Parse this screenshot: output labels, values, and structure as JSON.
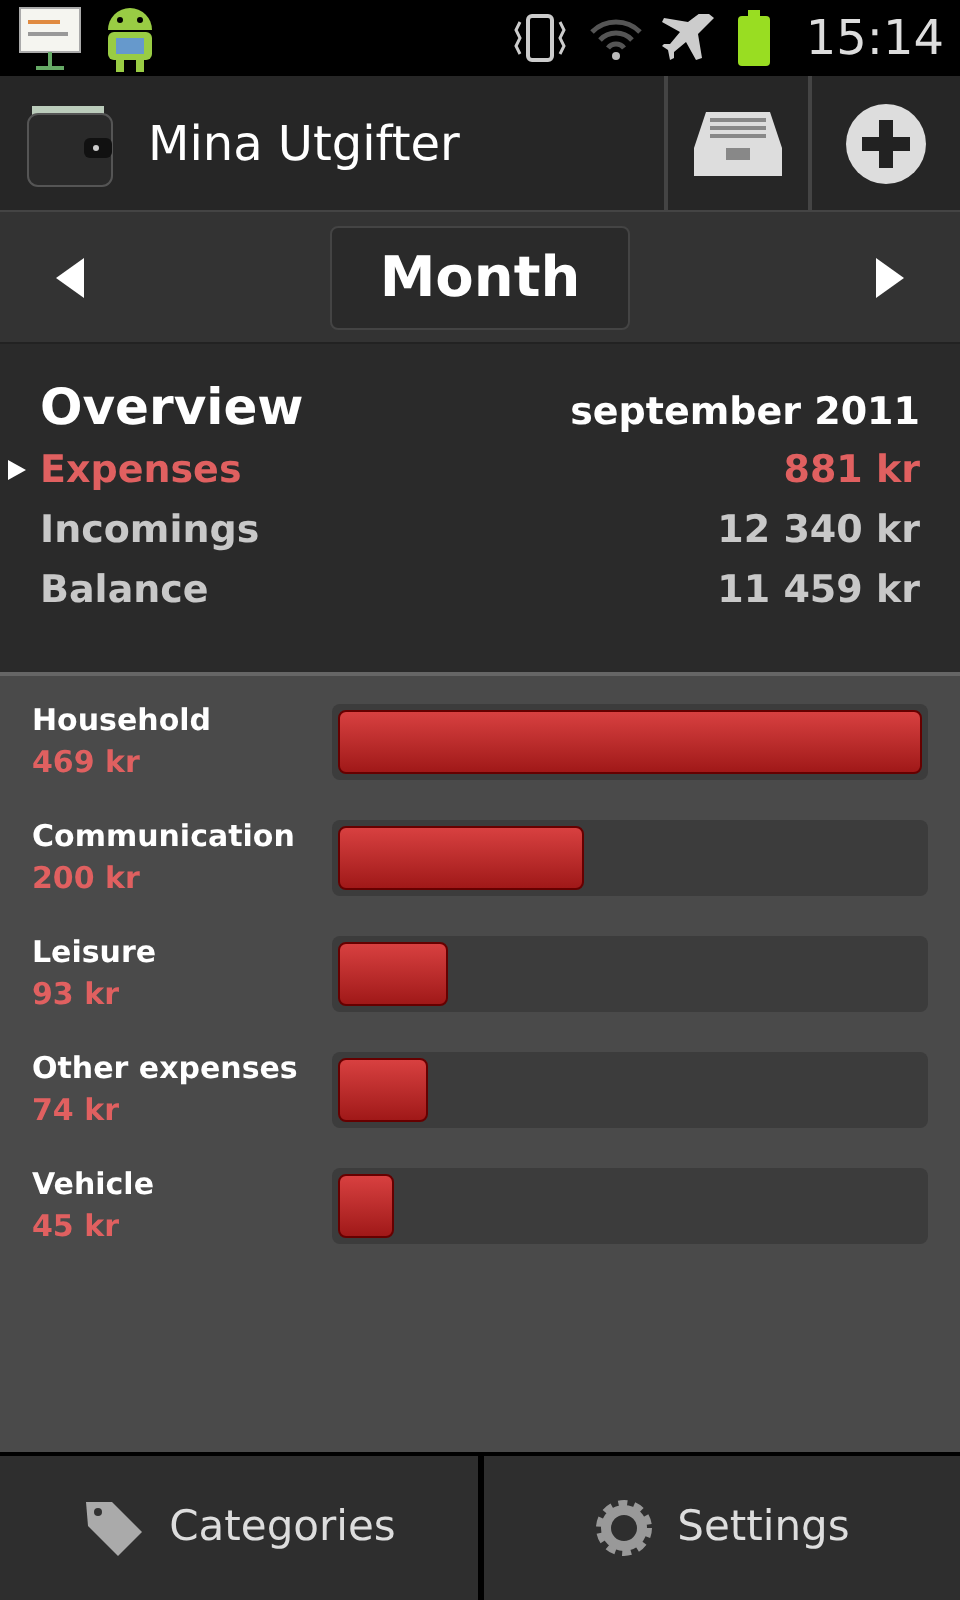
{
  "status_bar": {
    "time": "15:14"
  },
  "app_bar": {
    "title": "Mina Utgifter"
  },
  "period_nav": {
    "label": "Month"
  },
  "overview": {
    "title": "Overview",
    "period": "september 2011",
    "rows": [
      {
        "label": "Expenses",
        "value": "881 kr",
        "selected": true
      },
      {
        "label": "Incomings",
        "value": "12 340 kr",
        "selected": false
      },
      {
        "label": "Balance",
        "value": "11 459 kr",
        "selected": false
      }
    ]
  },
  "categories": [
    {
      "name": "Household",
      "amount": "469 kr",
      "level": 1
    },
    {
      "name": "Communication",
      "amount": "200 kr",
      "level": 0.42
    },
    {
      "name": "Leisure",
      "amount": "93 kr",
      "level": 0.19
    },
    {
      "name": "Other expenses",
      "amount": "74 kr",
      "level": 0.155
    },
    {
      "name": "Vehicle",
      "amount": "45 kr",
      "level": 0.095
    }
  ],
  "bottom_buttons": [
    {
      "label": "Categories",
      "kind": "tag"
    },
    {
      "label": "Settings",
      "kind": "gear"
    }
  ]
}
